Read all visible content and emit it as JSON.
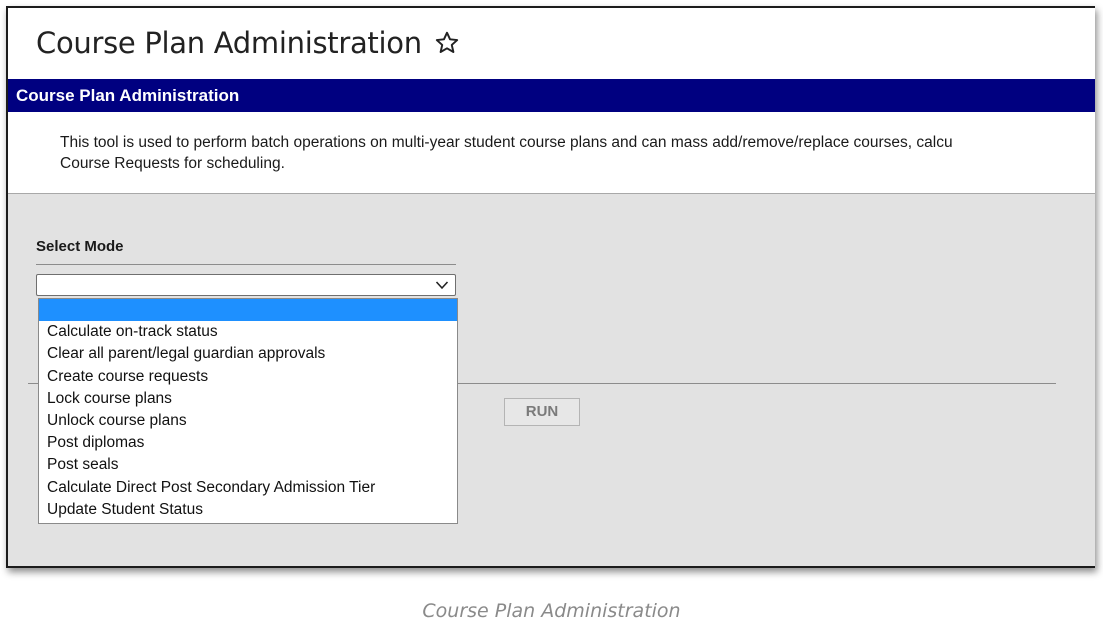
{
  "header": {
    "title": "Course Plan Administration",
    "favorite_icon": "star-outline-icon"
  },
  "section": {
    "title": "Course Plan Administration"
  },
  "description": "This tool is used to perform batch operations on multi-year student course plans and can mass add/remove/replace courses, calcu\nCourse Requests for scheduling.",
  "form": {
    "select_label": "Select Mode",
    "selected_value": "",
    "run_label": "RUN"
  },
  "dropdown": {
    "options": [
      "",
      "Calculate on-track status",
      "Clear all parent/legal guardian approvals",
      "Create course requests",
      "Lock course plans",
      "Unlock course plans",
      "Post diplomas",
      "Post seals",
      "Calculate Direct Post Secondary Admission Tier",
      "Update Student Status"
    ],
    "highlighted_index": 0
  },
  "caption": "Course Plan Administration",
  "colors": {
    "section_bar": "#000080",
    "highlight": "#1e90ff",
    "gray_background": "#e2e2e2"
  }
}
